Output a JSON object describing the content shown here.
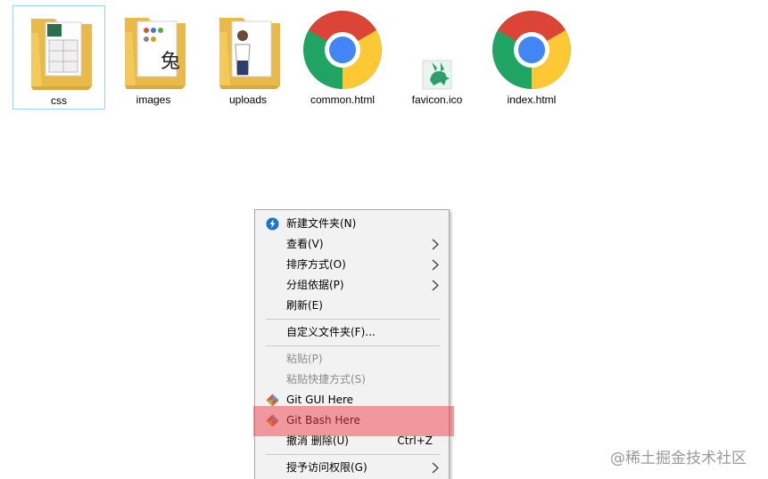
{
  "files": [
    {
      "name": "css",
      "icon": "folder-icon",
      "selected": true
    },
    {
      "name": "images",
      "icon": "folder-icon",
      "selected": false
    },
    {
      "name": "uploads",
      "icon": "folder-icon",
      "selected": false
    },
    {
      "name": "common.html",
      "icon": "chrome-icon",
      "selected": false
    },
    {
      "name": "favicon.ico",
      "icon": "favicon-icon",
      "selected": false
    },
    {
      "name": "index.html",
      "icon": "chrome-icon",
      "selected": false
    }
  ],
  "menu": {
    "new_folder": "新建文件夹(N)",
    "view": "查看(V)",
    "sort": "排序方式(O)",
    "group": "分组依据(P)",
    "refresh": "刷新(E)",
    "customize": "自定义文件夹(F)...",
    "paste": "粘贴(P)",
    "paste_shortcut": "粘贴快捷方式(S)",
    "git_gui": "Git GUI Here",
    "git_bash": "Git Bash Here",
    "undo_delete": "撤消 删除(U)",
    "undo_shortcut": "Ctrl+Z",
    "grant_access": "授予访问权限(G)"
  },
  "watermark": "@稀土掘金技术社区",
  "colors": {
    "highlight": "#ee3e48",
    "selection_border": "#99d1ff",
    "menu_bg": "#f2f2f2",
    "folder": "#f8d775"
  }
}
